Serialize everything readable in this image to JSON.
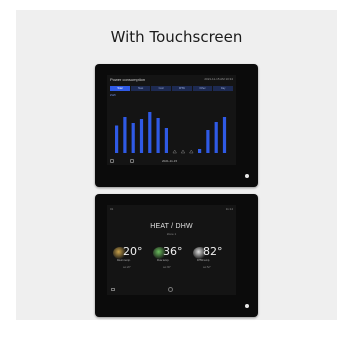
{
  "card": {
    "title": "With Touchscreen"
  },
  "power_screen": {
    "title": "Power consumption",
    "time": "2021-11-15  AM 10:34",
    "tabs": [
      "Total",
      "Heat",
      "Cool",
      "DHW",
      "Other",
      "Day"
    ],
    "subtitle": "kWh",
    "date": "2021-11-15",
    "bar_color": "#2f5ae6",
    "bar_levels": [
      0.55,
      0.72,
      0.6,
      0.68,
      0.82,
      0.7,
      0.5,
      0.0,
      0.0,
      0.0,
      0.08,
      0.46,
      0.62,
      0.72
    ]
  },
  "heat_screen": {
    "title": "HEAT / DHW",
    "subtitle": "Zone 1",
    "corner_left": "01",
    "corner_right": "11:14",
    "tiles": [
      {
        "value": "20°",
        "label": "Room temp.",
        "label2": "set 20°",
        "color": "#c9a24a"
      },
      {
        "value": "36°",
        "label": "Flow temp.",
        "label2": "set 36°",
        "color": "#6bbd5e"
      },
      {
        "value": "82°",
        "label": "DHW temp.",
        "label2": "set 52°",
        "color": "#dcdcdc"
      }
    ]
  },
  "colors": {
    "card_bg": "#efefef",
    "device_bg": "#0b0b0b",
    "accent": "#2f5ae6"
  }
}
